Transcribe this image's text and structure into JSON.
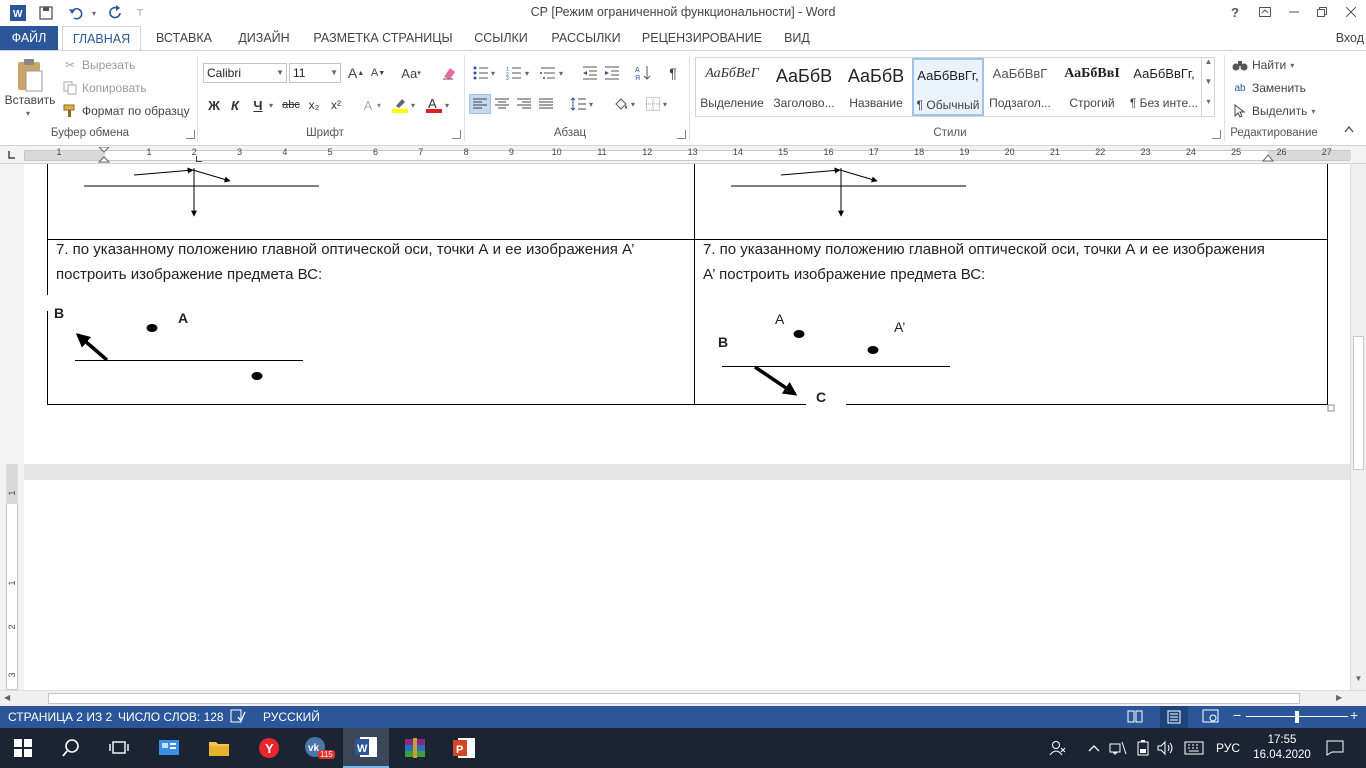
{
  "title_bar": {
    "doc_title": "СР [Режим ограниченной функциональности] - Word",
    "help": "?",
    "app_icon": "word-app-icon"
  },
  "tabs": {
    "file": "ФАЙЛ",
    "items": [
      "ГЛАВНАЯ",
      "ВСТАВКА",
      "ДИЗАЙН",
      "РАЗМЕТКА СТРАНИЦЫ",
      "ССЫЛКИ",
      "РАССЫЛКИ",
      "РЕЦЕНЗИРОВАНИЕ",
      "ВИД"
    ],
    "active": "ГЛАВНАЯ",
    "sign_in": "Вход"
  },
  "clipboard": {
    "paste": "Вставить",
    "cut": "Вырезать",
    "copy": "Копировать",
    "format_painter": "Формат по образцу",
    "label": "Буфер обмена"
  },
  "font": {
    "name": "Calibri",
    "size": "11",
    "label": "Шрифт",
    "bold": "Ж",
    "italic": "К",
    "underline": "Ч",
    "strike": "abc",
    "sub": "x₂",
    "sup": "x²",
    "case": "Aa",
    "grow": "A",
    "shrink": "A",
    "highlight_color": "#ffff00",
    "font_color": "#e02020"
  },
  "paragraph": {
    "label": "Абзац"
  },
  "styles": {
    "label": "Стили",
    "items": [
      {
        "sample": "АаБбВеГ",
        "name": "Выделение"
      },
      {
        "sample": "АаБбВ",
        "name": "Заголово..."
      },
      {
        "sample": "АаБбВ",
        "name": "Название"
      },
      {
        "sample": "АаБбВвГг,",
        "name": "¶ Обычный"
      },
      {
        "sample": "АаБбВвГ",
        "name": "Подзагол..."
      },
      {
        "sample": "АаБбВвI",
        "name": "Строгий"
      },
      {
        "sample": "АаБбВвГг,",
        "name": "¶ Без инте..."
      }
    ]
  },
  "editing": {
    "label": "Редактирование",
    "find": "Найти",
    "replace": "Заменить",
    "select": "Выделить"
  },
  "ruler": {
    "left_ticks": [
      "1"
    ],
    "ticks": [
      "1",
      "2",
      "3",
      "4",
      "5",
      "6",
      "7",
      "8",
      "9",
      "10",
      "11",
      "12",
      "13",
      "14",
      "15",
      "16",
      "17",
      "18",
      "19",
      "20",
      "21",
      "22",
      "23",
      "24",
      "25",
      "26",
      "27"
    ],
    "vticks": [
      "1",
      "1",
      "2",
      "3"
    ]
  },
  "document": {
    "left_task": "7. по указанному положению главной оптической оси, точки А и ее изображения А’ построить изображение предмета ВС:",
    "right_task_line1": "7. по указанному положению главной оптической оси, точки А и ее изображения",
    "right_task_line2": "А’ построить изображение предмета ВС:",
    "left_task_line1": "7. по указанному положению главной оптической оси, точки А и ее изображения А’",
    "left_task_line2": "построить изображение предмета ВС:",
    "left_labels": {
      "b": "B",
      "a": "A"
    },
    "right_labels": {
      "a": "A",
      "a_prime": "A’",
      "b": "B",
      "c": "C"
    }
  },
  "status": {
    "page": "СТРАНИЦА 2 ИЗ 2",
    "words": "ЧИСЛО СЛОВ: 128",
    "language": "РУССКИЙ",
    "zoom_minus": "−",
    "zoom_plus": "+"
  },
  "taskbar": {
    "vk_badge": "115",
    "lang": "РУС",
    "time": "17:55",
    "date": "16.04.2020"
  }
}
